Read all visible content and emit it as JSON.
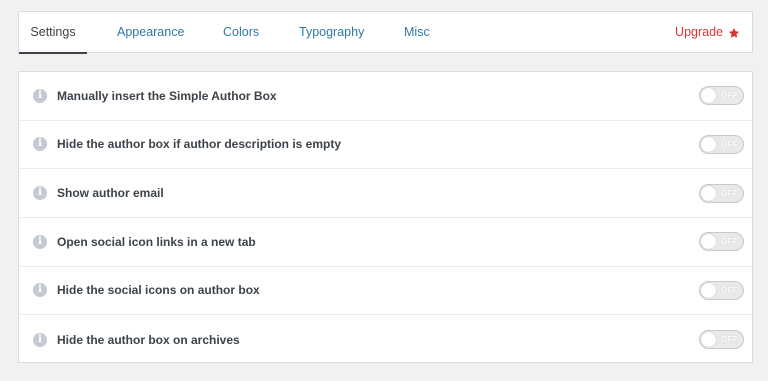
{
  "tabs": [
    {
      "label": "Settings",
      "active": true
    },
    {
      "label": "Appearance",
      "active": false
    },
    {
      "label": "Colors",
      "active": false
    },
    {
      "label": "Typography",
      "active": false
    },
    {
      "label": "Misc",
      "active": false
    }
  ],
  "upgrade": {
    "label": "Upgrade",
    "icon": "star-icon",
    "color": "#d63638"
  },
  "settings": [
    {
      "label": "Manually insert the Simple Author Box",
      "toggle": "OFF",
      "enabled": false
    },
    {
      "label": "Hide the author box if author description is empty",
      "toggle": "OFF",
      "enabled": false
    },
    {
      "label": "Show author email",
      "toggle": "OFF",
      "enabled": false
    },
    {
      "label": "Open social icon links in a new tab",
      "toggle": "OFF",
      "enabled": false
    },
    {
      "label": "Hide the social icons on author box",
      "toggle": "OFF",
      "enabled": false
    },
    {
      "label": "Hide the author box on archives",
      "toggle": "OFF",
      "enabled": false
    }
  ],
  "colors": {
    "link": "#2f7aa1",
    "text": "#3c434a",
    "info_icon": "#c3cad3"
  }
}
